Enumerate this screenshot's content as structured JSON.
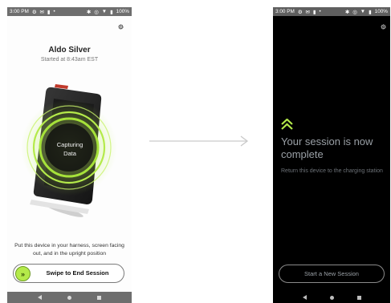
{
  "status_bar": {
    "time": "3:00 PM",
    "icons_left": [
      "settings-icon",
      "mail-icon",
      "person-icon",
      "dot-icon"
    ],
    "icons_right": [
      "bluetooth-icon",
      "location-icon",
      "wifi-icon",
      "battery-icon"
    ],
    "battery": "100%"
  },
  "capture_screen": {
    "name": "Aldo Silver",
    "started": "Started at 8:43am EST",
    "capture_line1": "Capturing",
    "capture_line2": "Data",
    "instruction": "Put this device in your harness, screen facing out, and in the upright position",
    "swipe_label": "Swipe to End Session",
    "swipe_icon": "double-chevron-right-icon",
    "accent_color": "#b4ea4a"
  },
  "complete_screen": {
    "title": "Your session is now complete",
    "subtitle": "Return this device to the charging station",
    "button_label": "Start a New Session",
    "accent_color": "#b4ea4a"
  },
  "nav_bar": {
    "icons": [
      "back-icon",
      "home-icon",
      "recents-icon"
    ]
  }
}
